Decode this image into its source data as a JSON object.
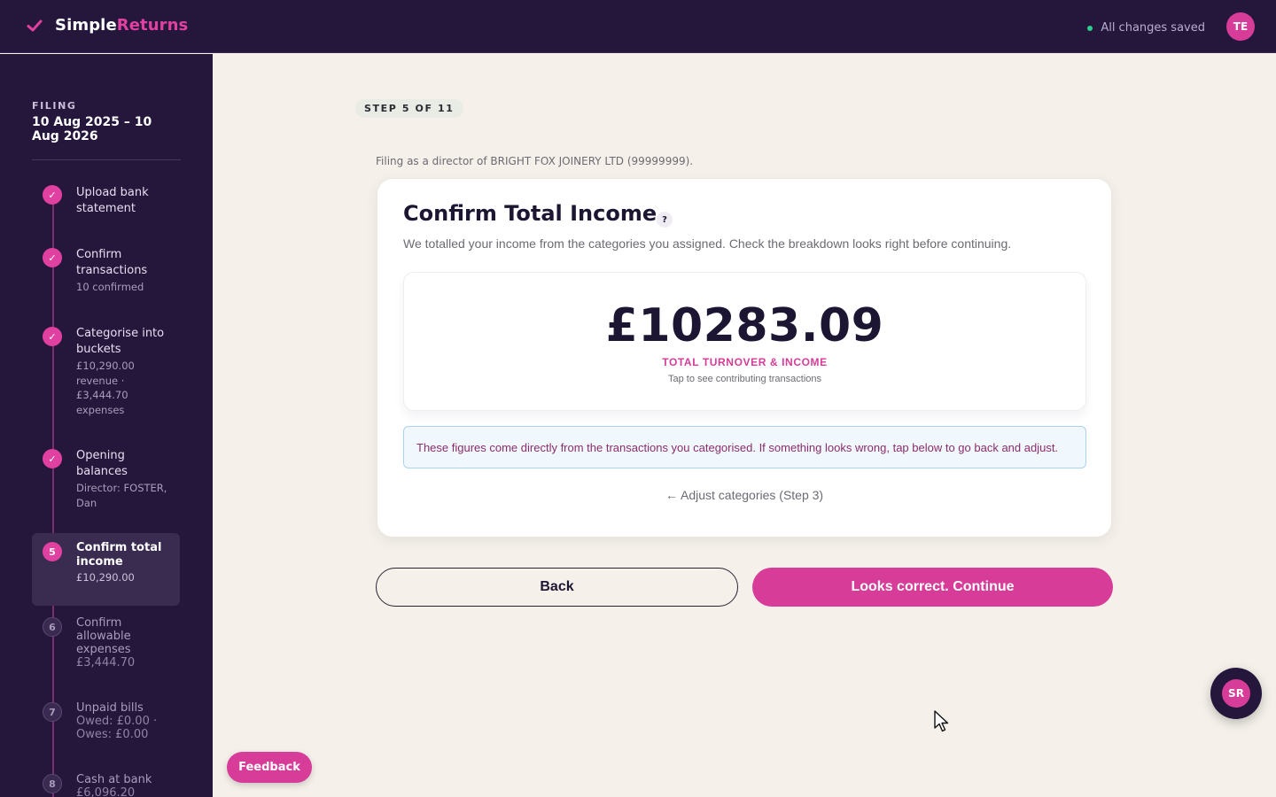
{
  "header": {
    "brand_primary": "Simple",
    "brand_accent": "Returns",
    "save_status": "All changes saved",
    "avatar_initials": "TE"
  },
  "sidebar": {
    "filing_label": "FILING",
    "filing_dates": "10 Aug 2025 – 10 Aug 2026",
    "steps": [
      {
        "marker": "✓",
        "title": "Upload bank statement",
        "sub": "",
        "state": "done"
      },
      {
        "marker": "✓",
        "title": "Confirm transactions",
        "sub": "10 confirmed",
        "state": "done"
      },
      {
        "marker": "✓",
        "title": "Categorise into buckets",
        "sub": "£10,290.00 revenue · £3,444.70 expenses",
        "state": "done"
      },
      {
        "marker": "✓",
        "title": "Opening balances",
        "sub": "Director: FOSTER, Dan",
        "state": "done"
      },
      {
        "marker": "5",
        "title": "Confirm total income",
        "sub": "£10,290.00",
        "state": "current"
      },
      {
        "marker": "6",
        "title": "Confirm allowable expenses",
        "sub": "£3,444.70",
        "state": "todo"
      },
      {
        "marker": "7",
        "title": "Unpaid bills",
        "sub": "Owed: £0.00 · Owes: £0.00",
        "state": "todo"
      },
      {
        "marker": "8",
        "title": "Cash at bank",
        "sub": "£6,096.20",
        "state": "todo"
      }
    ]
  },
  "main": {
    "step_pill": "STEP 5 OF 11",
    "filing_note": "Filing as a director of BRIGHT FOX JOINERY LTD (99999999).",
    "card": {
      "title": "Confirm Total Income",
      "help": "?",
      "description": "We totalled your income from the categories you assigned. Check the breakdown looks right before continuing.",
      "total_amount": "£10283.09",
      "total_label": "TOTAL TURNOVER & INCOME",
      "total_hint": "Tap to see contributing transactions",
      "info": "These figures come directly from the transactions you categorised. If something looks wrong, tap below to go back and adjust.",
      "adjust_link": "← Adjust categories (Step 3)"
    },
    "back_label": "Back",
    "continue_label": "Looks correct. Continue"
  },
  "feedback_label": "Feedback",
  "chat_initials": "SR",
  "colors": {
    "brand_dark": "#25163c",
    "accent": "#d63c98",
    "background": "#f5f1ea",
    "saved_dot": "#2ecc8f"
  }
}
